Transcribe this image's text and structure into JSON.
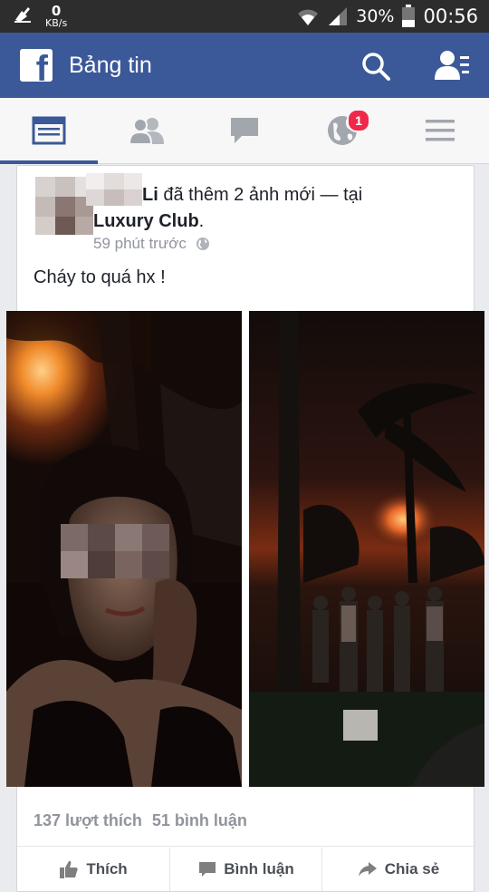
{
  "status_bar": {
    "net_speed_value": "0",
    "net_speed_unit": "KB/s",
    "battery_percent": "30%",
    "time": "00:56"
  },
  "header": {
    "app_logo": "f",
    "title": "Bảng tin"
  },
  "tabs": [
    {
      "name": "news-feed",
      "active": true
    },
    {
      "name": "friend-requests",
      "active": false
    },
    {
      "name": "messages",
      "active": false
    },
    {
      "name": "notifications",
      "active": false,
      "badge": "1"
    },
    {
      "name": "more",
      "active": false
    }
  ],
  "post": {
    "author_suffix": "Li",
    "action_text": " đã thêm 2 ảnh mới — tại",
    "place": "Luxury Club",
    "place_suffix": ".",
    "time_ago": "59 phút trước",
    "privacy_icon": "globe-icon",
    "status_text": "Cháy to quá hx !",
    "likes": "137 lượt thích",
    "comments": "51 bình luận",
    "actions": {
      "like": "Thích",
      "comment": "Bình luận",
      "share": "Chia sẻ"
    }
  },
  "colors": {
    "brand": "#3b5998",
    "status_bar": "#2d2d2d",
    "badge": "#f02849"
  }
}
